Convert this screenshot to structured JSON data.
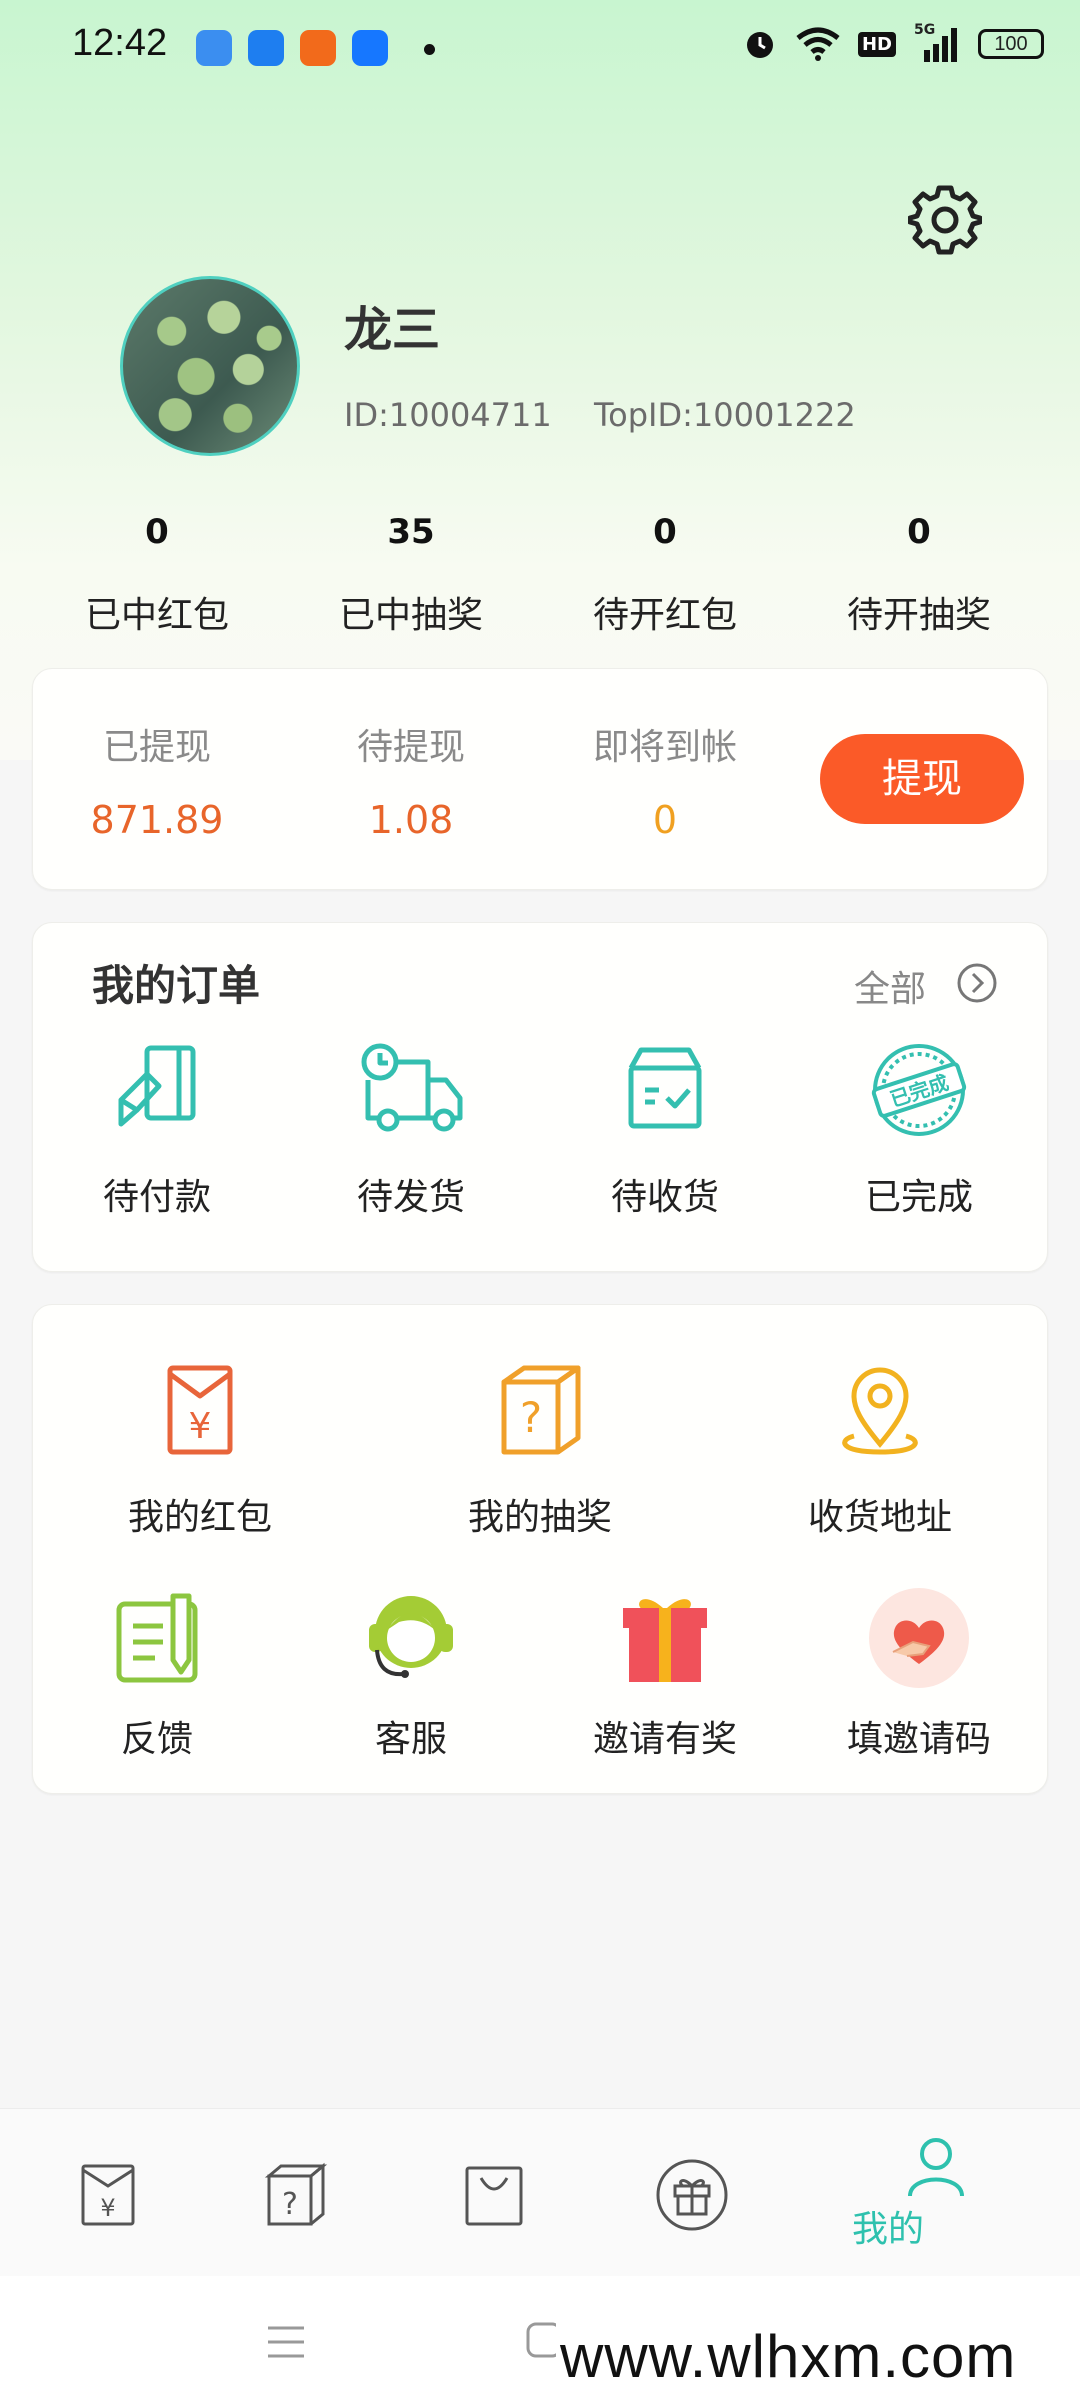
{
  "status_bar": {
    "time": "12:42",
    "battery": "100",
    "network": "5G",
    "hd": "HD"
  },
  "profile": {
    "name": "龙三",
    "id_text": "ID:10004711",
    "top_id_text": "TopID:10001222"
  },
  "stats": [
    {
      "value": "0",
      "label": "已中红包"
    },
    {
      "value": "35",
      "label": "已中抽奖"
    },
    {
      "value": "0",
      "label": "待开红包"
    },
    {
      "value": "0",
      "label": "待开抽奖"
    }
  ],
  "wallet": {
    "items": [
      {
        "title": "已提现",
        "value": "871.89"
      },
      {
        "title": "待提现",
        "value": "1.08"
      },
      {
        "title": "即将到帐",
        "value": "0"
      }
    ],
    "button": "提现"
  },
  "orders": {
    "title": "我的订单",
    "all": "全部",
    "items": [
      {
        "label": "待付款",
        "icon": "card-payment-icon"
      },
      {
        "label": "待发货",
        "icon": "delivery-truck-icon"
      },
      {
        "label": "待收货",
        "icon": "package-box-icon"
      },
      {
        "label": "已完成",
        "icon": "completed-stamp-icon",
        "stamp": "已完成"
      }
    ]
  },
  "tools": {
    "row1": [
      {
        "label": "我的红包",
        "icon": "red-envelope-icon",
        "symbol": "¥"
      },
      {
        "label": "我的抽奖",
        "icon": "mystery-box-icon",
        "symbol": "?"
      },
      {
        "label": "收货地址",
        "icon": "location-pin-icon"
      }
    ],
    "row2": [
      {
        "label": "反馈",
        "icon": "feedback-icon"
      },
      {
        "label": "客服",
        "icon": "customer-service-icon"
      },
      {
        "label": "邀请有奖",
        "icon": "gift-icon"
      },
      {
        "label": "填邀请码",
        "icon": "heart-hand-icon"
      }
    ]
  },
  "tabbar": {
    "active_label": "我的",
    "items": [
      "red-envelope-tab-icon",
      "mystery-box-tab-icon",
      "shop-bag-tab-icon",
      "gift-tab-icon",
      "profile-tab-icon"
    ]
  },
  "watermark": "www.wlhxm.com",
  "colors": {
    "accent": "#2ec1ae",
    "withdraw_button": "#fb5a28",
    "value_orange": "#e8652a",
    "value_yellow": "#f0a020"
  }
}
